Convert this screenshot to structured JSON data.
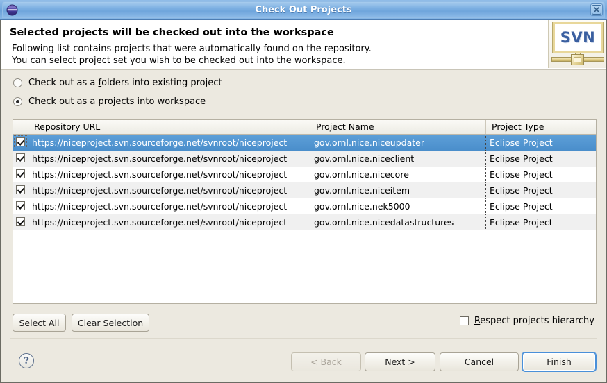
{
  "window": {
    "title": "Check Out Projects",
    "app_icon": "eclipse-globe-icon",
    "close_icon": "close-icon"
  },
  "header": {
    "title": "Selected projects will be checked out into the workspace",
    "line1": "Following list contains projects that were automatically found on the repository.",
    "line2": "You can select project set you wish to be checked out into the workspace.",
    "logo_text": "SVN"
  },
  "options": {
    "folders": {
      "pre": "Check out as a ",
      "mnemonic": "f",
      "post": "olders into existing project",
      "selected": false
    },
    "projects": {
      "pre": "Check out as a ",
      "mnemonic": "p",
      "post": "rojects into workspace",
      "selected": true
    }
  },
  "table": {
    "columns": [
      "Repository URL",
      "Project Name",
      "Project Type"
    ],
    "rows": [
      {
        "checked": true,
        "url": "https://niceproject.svn.sourceforge.net/svnroot/niceproject",
        "name": "gov.ornl.nice.niceupdater",
        "type": "Eclipse Project",
        "selected": true
      },
      {
        "checked": true,
        "url": "https://niceproject.svn.sourceforge.net/svnroot/niceproject",
        "name": "gov.ornl.nice.niceclient",
        "type": "Eclipse Project",
        "selected": false
      },
      {
        "checked": true,
        "url": "https://niceproject.svn.sourceforge.net/svnroot/niceproject",
        "name": "gov.ornl.nice.nicecore",
        "type": "Eclipse Project",
        "selected": false
      },
      {
        "checked": true,
        "url": "https://niceproject.svn.sourceforge.net/svnroot/niceproject",
        "name": "gov.ornl.nice.niceitem",
        "type": "Eclipse Project",
        "selected": false
      },
      {
        "checked": true,
        "url": "https://niceproject.svn.sourceforge.net/svnroot/niceproject",
        "name": "gov.ornl.nice.nek5000",
        "type": "Eclipse Project",
        "selected": false
      },
      {
        "checked": true,
        "url": "https://niceproject.svn.sourceforge.net/svnroot/niceproject",
        "name": "gov.ornl.nice.nicedatastructures",
        "type": "Eclipse Project",
        "selected": false
      }
    ]
  },
  "actions": {
    "select_all": {
      "mnemonic": "S",
      "rest": "elect All"
    },
    "clear_selection": {
      "mnemonic": "C",
      "rest": "lear Selection"
    },
    "respect_hierarchy": {
      "mnemonic": "R",
      "rest": "espect projects hierarchy",
      "checked": false
    }
  },
  "footer": {
    "help_icon": "?",
    "back": {
      "pre": "< ",
      "mnemonic": "B",
      "rest": "ack",
      "disabled": true
    },
    "next": {
      "pre": "",
      "mnemonic": "N",
      "rest": "ext >",
      "disabled": false
    },
    "cancel": {
      "label": "Cancel",
      "disabled": false
    },
    "finish": {
      "pre": "",
      "mnemonic": "F",
      "rest": "inish",
      "disabled": false,
      "focused": true
    }
  },
  "colors": {
    "titlebar": "#75a9de",
    "selection": "#5d9fd8",
    "dialog_bg": "#ece9e0",
    "svn_blue": "#3a5fa0",
    "focus_blue": "#4a90d9"
  }
}
